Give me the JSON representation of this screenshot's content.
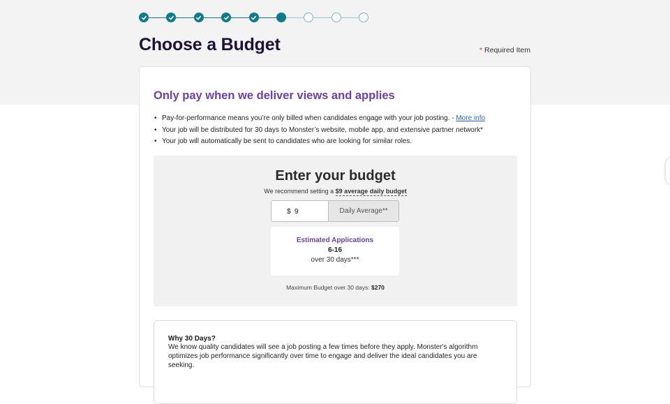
{
  "stepper": {
    "steps": [
      {
        "state": "complete",
        "icon": "check-icon"
      },
      {
        "state": "complete",
        "icon": "check-icon"
      },
      {
        "state": "complete",
        "icon": "check-icon"
      },
      {
        "state": "complete",
        "icon": "check-icon"
      },
      {
        "state": "complete",
        "icon": "check-icon"
      },
      {
        "state": "current"
      },
      {
        "state": "upcoming"
      },
      {
        "state": "upcoming"
      },
      {
        "state": "upcoming"
      }
    ],
    "accent_color": "#0f7b8a"
  },
  "header": {
    "title": "Choose a Budget",
    "required_star": "*",
    "required_label": "Required Item"
  },
  "card": {
    "heading": "Only pay when we deliver views and applies",
    "bullet_1": "Pay-for-performance means you’re only billed when candidates engage with your job posting. - ",
    "bullet_1_link": "More info",
    "bullet_2": "Your job will be distributed for 30 days to Monster’s website, mobile app, and extensive partner network*",
    "bullet_3": "Your job will automatically be sent to candidates who are looking for similar roles."
  },
  "budget": {
    "title": "Enter your budget",
    "recommend_prefix": "We recommend setting a ",
    "recommend_value": "$9 average daily budget",
    "currency": "$",
    "input_value": "9",
    "suffix": "Daily Average**",
    "estimate_label": "Estimated Applications",
    "estimate_range": "6-16",
    "estimate_period": "over 30 days***",
    "max_prefix": "Maximum Budget over 30 days: ",
    "max_value": "$270"
  },
  "why": {
    "title": "Why 30 Days?",
    "body": "We know quality candidates will see a job posting a few times before they apply. Monster's algorithm optimizes job performance significantly over time to engage and deliver the ideal candidates you are seeking."
  },
  "colors": {
    "brand_purple": "#6e3fa6",
    "title_navy": "#1c1239",
    "link_blue": "#2b5fd1",
    "required_red": "#d0342c"
  }
}
